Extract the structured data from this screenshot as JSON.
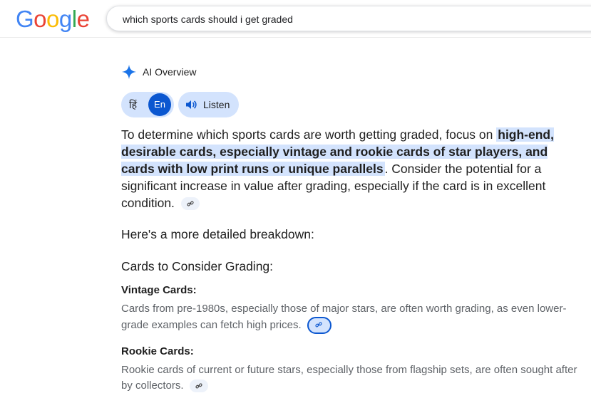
{
  "header": {
    "logo": "Google",
    "search_query": "which sports cards should i get graded"
  },
  "ai_overview": {
    "title": "AI Overview",
    "lang_hindi": "हिं",
    "lang_english": "En",
    "listen_label": "Listen",
    "intro_before": "To determine which sports cards are worth getting graded, focus on ",
    "intro_highlight": "high-end, desirable cards, especially vintage and rookie cards of star players, and cards with low print runs or unique parallels",
    "intro_after": ". Consider the potential for a significant increase in value after grading, especially if the card is in excellent condition.",
    "breakdown": "Here's a more detailed breakdown:",
    "section_heading": "Cards to Consider Grading:",
    "items": [
      {
        "title": "Vintage Cards:",
        "text": "Cards from pre-1980s, especially those of major stars, are often worth grading, as even lower-grade examples can fetch high prices."
      },
      {
        "title": "Rookie Cards:",
        "text": "Rookie cards of current or future stars, especially those from flagship sets, are often sought after by collectors."
      }
    ]
  },
  "colors": {
    "accent": "#0b57d0",
    "highlight": "#d3e3fd"
  }
}
